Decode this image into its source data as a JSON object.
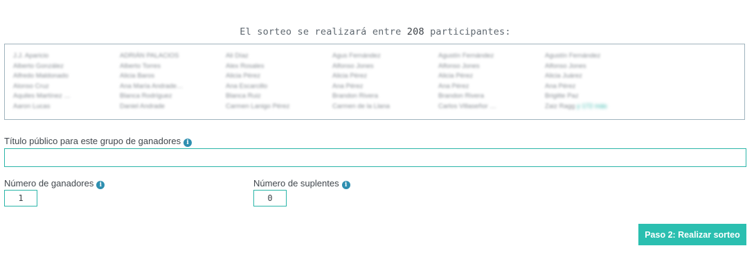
{
  "heading": {
    "prefix": "El sorteo se realizará entre ",
    "count": "208",
    "suffix": " participantes:"
  },
  "participants": {
    "columns": [
      [
        "J.J. Aparicio",
        "Alberto González",
        "Alfredo Maldonado",
        "Alonso Cruz",
        "Aquiles Martínez …",
        "Aaron Lucas"
      ],
      [
        "ADRIÁN PALACIOS",
        "Alberto Torres",
        "Alicia Baros",
        "Ana María Andrade…",
        "Blanca Rodríguez",
        "Daniel Andrade"
      ],
      [
        "Ali Díaz",
        "Alex Rosales",
        "Alicia Pérez",
        "Ana Escarcillo",
        "Blanca Ruiz",
        "Carmen Lanigo Pérez"
      ],
      [
        "Agus Fernández",
        "Alfonso Jones",
        "Alicia Pérez",
        "Ana Pérez",
        "Brandon Rivera",
        "Carmen de la Llana"
      ],
      [
        "Agustín Fernández",
        "Alfonso Jones",
        "Alicia Pérez",
        "Ana Pérez",
        "Brandon Rivera",
        "Carlos Villaseñor …"
      ],
      [
        "Agustín Fernández",
        "Alfonso Jones",
        "Alicia Juárez",
        "Ana Pérez",
        "Brigitte Paz",
        "Zaiz Ragg"
      ]
    ],
    "more_link": "y 172 más"
  },
  "title_field": {
    "label": "Título público para este grupo de ganadores",
    "value": ""
  },
  "winners_field": {
    "label": "Número de ganadores",
    "value": "1"
  },
  "substitutes_field": {
    "label": "Número de suplentes",
    "value": "0"
  },
  "info_icon_glyph": "i",
  "submit_button": {
    "label": "Paso 2: Realizar sorteo"
  },
  "colors": {
    "accent": "#2bbfb0",
    "info": "#2e8fb0",
    "border": "#9fb3bd"
  }
}
